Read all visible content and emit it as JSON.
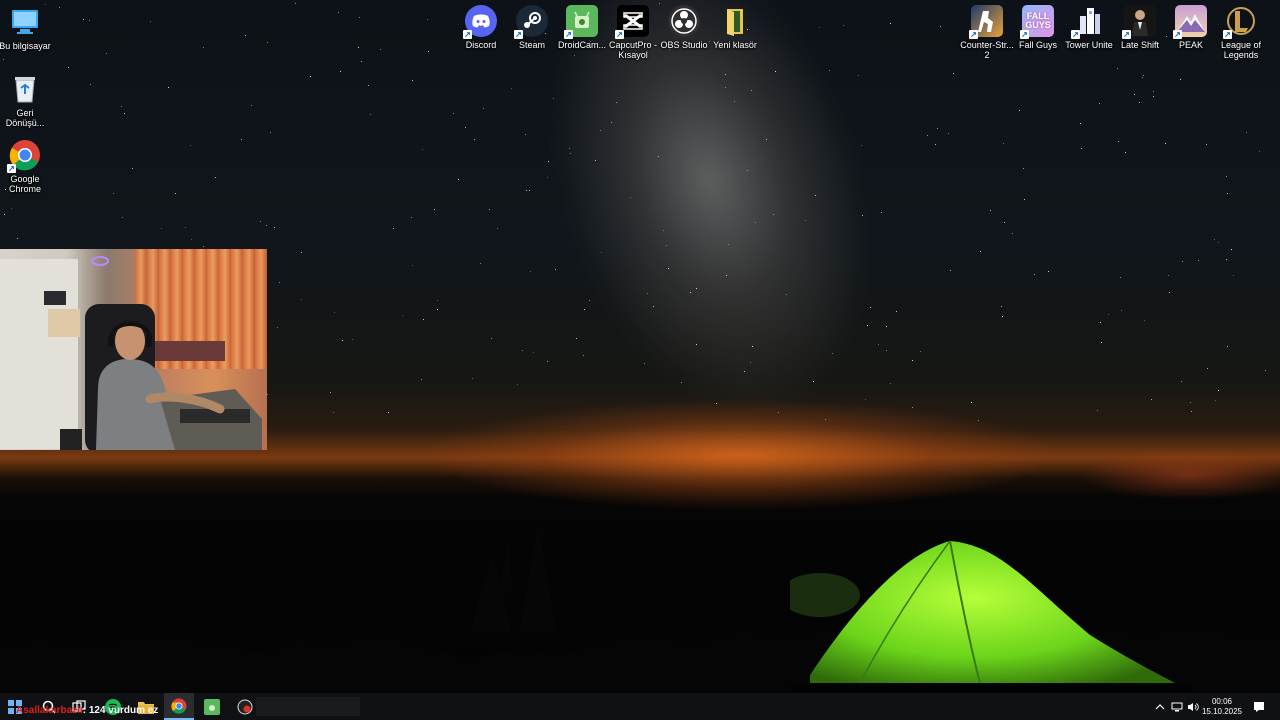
{
  "desktop": {
    "left_icons": [
      {
        "name": "this-pc-icon",
        "label": "Bu bilgisayar"
      },
      {
        "name": "recycle-bin-icon",
        "label": "Geri\nDönüşü..."
      },
      {
        "name": "google-chrome-icon",
        "label": "Google\nChrome"
      }
    ],
    "top_icons": [
      {
        "name": "discord-icon",
        "label": "Discord",
        "color": "#5865f2"
      },
      {
        "name": "steam-icon",
        "label": "Steam",
        "color": "#1b2838"
      },
      {
        "name": "droidcam-icon",
        "label": "DroidCam...",
        "color": "#4caf50"
      },
      {
        "name": "capcut-icon",
        "label": "CapcutPro -\nKısayol",
        "color": "#000000"
      },
      {
        "name": "obs-studio-icon",
        "label": "OBS Studio",
        "color": "#302e31"
      },
      {
        "name": "folder-icon",
        "label": "Yeni klasör",
        "color": "#e8c24a"
      }
    ],
    "right_icons": [
      {
        "name": "counter-strike-icon",
        "label": "Counter-Str...\n2",
        "color": "#e8a23a"
      },
      {
        "name": "fall-guys-icon",
        "label": "Fall Guys",
        "color": "#b99ae8"
      },
      {
        "name": "tower-unite-icon",
        "label": "Tower Unite",
        "color": "#e8eef8"
      },
      {
        "name": "late-shift-icon",
        "label": "Late Shift",
        "color": "#1a1a1a"
      },
      {
        "name": "peak-icon",
        "label": "PEAK",
        "color": "#c8a0d8"
      },
      {
        "name": "league-of-legends-icon",
        "label": "League of\nLegends",
        "color": "#c8a050"
      }
    ]
  },
  "taskbar": {
    "overlay_user": "Asallakarbazlı",
    "overlay_msg": ": 124 vurdum ez",
    "clock_time": "00:06",
    "clock_date": "15.10.2025"
  }
}
